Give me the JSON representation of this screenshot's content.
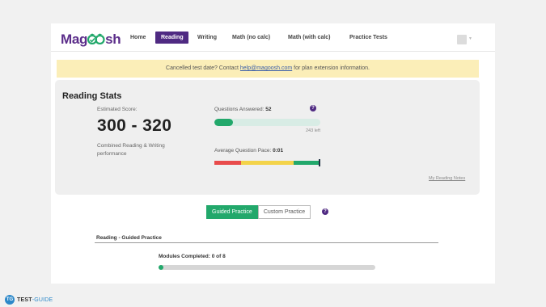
{
  "nav": {
    "logo_left": "Mag",
    "logo_right": "sh",
    "items": [
      {
        "label": "Home"
      },
      {
        "label": "Reading",
        "active": true
      },
      {
        "label": "Writing"
      },
      {
        "label": "Math (no calc)"
      },
      {
        "label": "Math (with calc)"
      },
      {
        "label": "Practice Tests"
      }
    ]
  },
  "banner": {
    "text_before": "Cancelled test date? Contact ",
    "email": "help@magoosh.com",
    "text_after": " for plan extension information."
  },
  "stats": {
    "title": "Reading Stats",
    "estimated_label": "Estimated Score:",
    "score": "300 - 320",
    "score_caption": "Combined Reading & Writing performance",
    "questions_label": "Questions Answered:",
    "questions_value": "52",
    "questions_progress": 0.176,
    "questions_left": "243 left",
    "pace_label": "Average Question Pace:",
    "pace_value": "0:01",
    "pace_segments": [
      {
        "color": "#e84b4b",
        "share": 0.25
      },
      {
        "color": "#f3d34a",
        "share": 0.5
      },
      {
        "color": "#22a86b",
        "share": 0.25
      }
    ],
    "notes_link": "My Reading Notes"
  },
  "practice_toggle": {
    "options": [
      "Guided Practice",
      "Custom Practice"
    ],
    "selected": "Guided Practice"
  },
  "guided": {
    "section_title": "Reading - Guided Practice",
    "modules_label": "Modules Completed: 0 of 8",
    "modules_completed": 0,
    "modules_total": 8
  },
  "watermark": {
    "badge": "TG",
    "brand_bold": "TEST",
    "brand_rest": "-GUIDE"
  },
  "colors": {
    "brand_purple": "#4f2a82",
    "accent_green": "#22a86b",
    "banner_yellow": "#fbeeb8"
  }
}
